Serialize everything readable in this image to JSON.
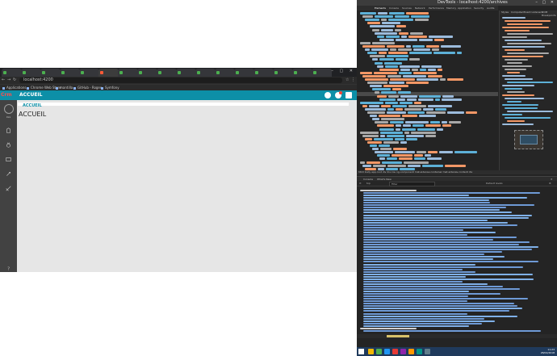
{
  "browser": {
    "tabs": [
      "",
      "",
      "",
      "",
      "",
      "",
      "",
      "",
      "",
      "",
      "",
      "",
      "",
      "",
      "",
      "",
      ""
    ],
    "active_tab_index": 5,
    "url": "localhost:4200",
    "bookmarks": [
      "Applications",
      "Chrome Web Store",
      "mantilla",
      "GitHub - Roges",
      "Symfony"
    ]
  },
  "app": {
    "brand": "Crm",
    "header_title": "ACCUEIL",
    "breadcrumb": "ACCUEIL",
    "heading": "ACCUEIL",
    "username": "Xxx",
    "notification_count": "",
    "colors": {
      "header": "#0d8fa7",
      "sidebar": "#424242",
      "content": "#e6e6e6"
    }
  },
  "devtools": {
    "title": "DevTools - localhost:4200/archives",
    "tabs": [
      "Elements",
      "Console",
      "Sources",
      "Network",
      "Performance",
      "Memory",
      "Application",
      "Security",
      "Audits"
    ],
    "styles_tabs": [
      "Styles",
      "Computed",
      "Event Listeners",
      "DOM Breakpoints"
    ],
    "breadcrumb": "html  body  app-root  div  div.row  ng-component  mat-sidenav-container  mat-sidenav-content  div",
    "console_tabs": [
      "Console",
      "What's New"
    ],
    "console_context": "top",
    "console_filter_placeholder": "Filter",
    "console_level": "Default levels"
  },
  "taskbar": {
    "time": "11:23",
    "date": "28/02/2018"
  }
}
